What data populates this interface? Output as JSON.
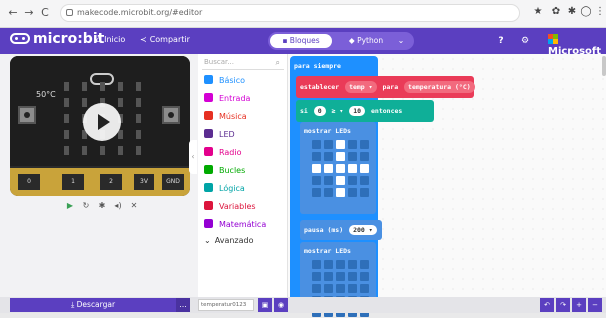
{
  "browser": {
    "back": "←",
    "forward": "→",
    "reload": "C",
    "url": "makecode.microbit.org/#editor"
  },
  "header": {
    "home": "Inicio",
    "share": "Compartir",
    "blocks": "Bloques",
    "python": "Python",
    "help": "?",
    "settings": "⚙",
    "microsoft": "Microsoft"
  },
  "simulator": {
    "temp": "50°C",
    "pins": [
      "0",
      "1",
      "2",
      "3V",
      "GND"
    ]
  },
  "toolbox": {
    "search_placeholder": "Buscar...",
    "categories": [
      {
        "label": "Básico",
        "color": "#1e90ff"
      },
      {
        "label": "Entrada",
        "color": "#d400d4"
      },
      {
        "label": "Música",
        "color": "#e63022"
      },
      {
        "label": "LED",
        "color": "#5c2d91"
      },
      {
        "label": "Radio",
        "color": "#e3008c"
      },
      {
        "label": "Bucles",
        "color": "#00aa00"
      },
      {
        "label": "Lógica",
        "color": "#00a4a6"
      },
      {
        "label": "Variables",
        "color": "#dc143c"
      },
      {
        "label": "Matemática",
        "color": "#9400d3"
      }
    ],
    "advanced": "Avanzado"
  },
  "workspace": {
    "forever": "para siempre",
    "set": "establecer",
    "var": "temp ▾",
    "to": "para",
    "temperature": "temperatura (°C)",
    "if": "si",
    "op_left": "0",
    "op": "≥ ▾",
    "op_right": "10",
    "then": "entonces",
    "show_leds": "mostrar LEDs",
    "pause": "pausa (ms)",
    "pause_val": "200 ▾",
    "show_leds2": "mostrar LEDs",
    "led_pattern": [
      [
        0,
        0,
        1,
        0,
        0
      ],
      [
        0,
        0,
        1,
        0,
        0
      ],
      [
        1,
        1,
        1,
        1,
        1
      ],
      [
        0,
        0,
        1,
        0,
        0
      ],
      [
        0,
        0,
        1,
        0,
        0
      ]
    ]
  },
  "footer": {
    "download": "Descargar",
    "more": "...",
    "project_name": "temperatur0123"
  }
}
